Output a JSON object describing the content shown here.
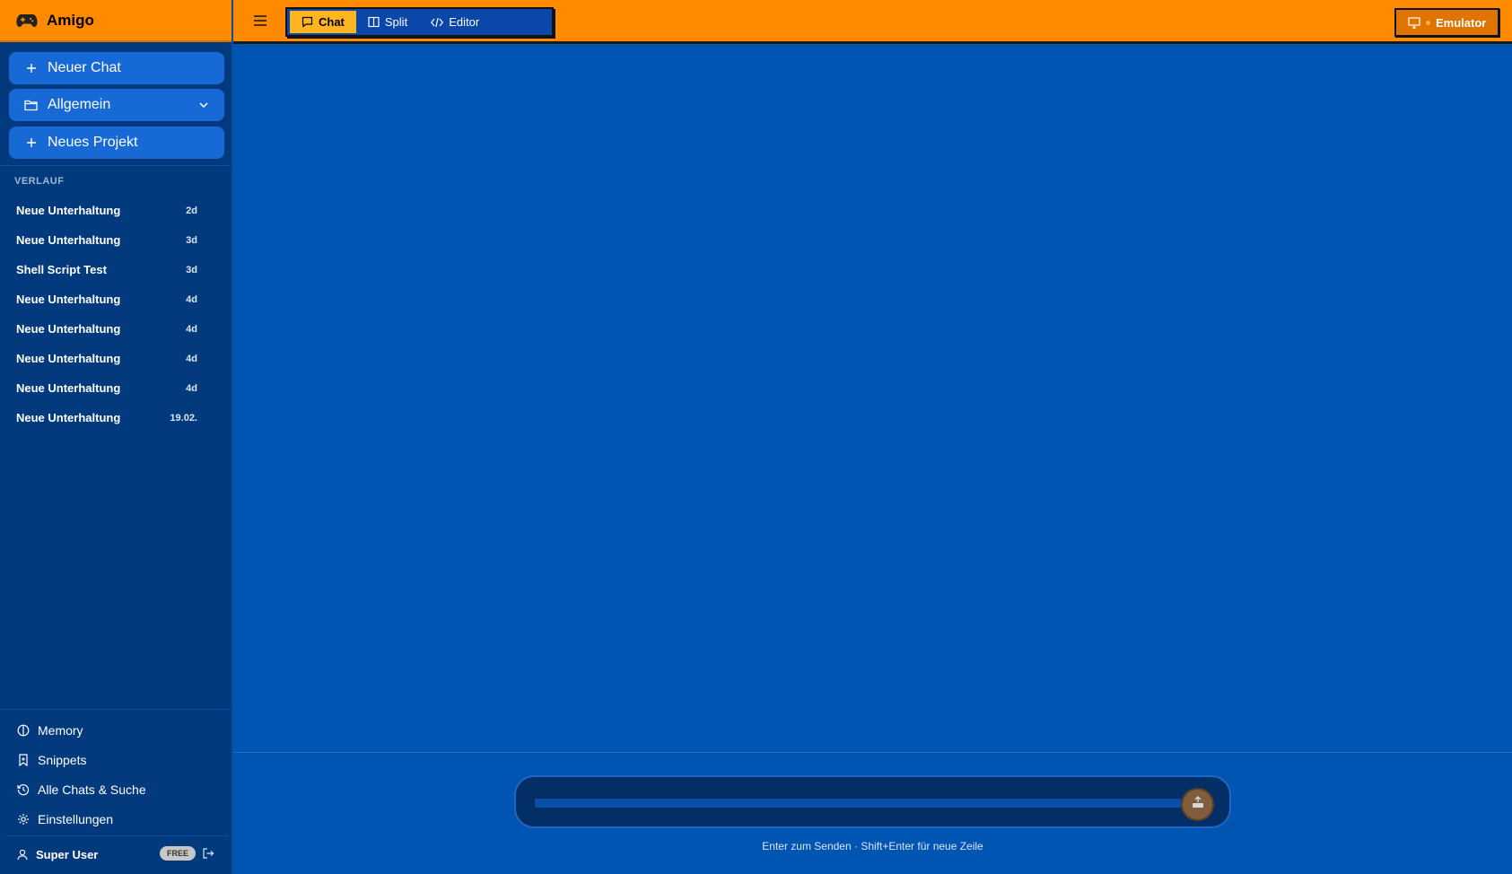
{
  "app": {
    "title": "Amigo"
  },
  "sidebar": {
    "new_chat": "Neuer Chat",
    "project_select": "Allgemein",
    "new_project": "Neues Projekt",
    "history_label": "VERLAUF",
    "history": [
      {
        "title": "Neue Unterhaltung",
        "time": "2d"
      },
      {
        "title": "Neue Unterhaltung",
        "time": "3d"
      },
      {
        "title": "Shell Script Test",
        "time": "3d"
      },
      {
        "title": "Neue Unterhaltung",
        "time": "4d"
      },
      {
        "title": "Neue Unterhaltung",
        "time": "4d"
      },
      {
        "title": "Neue Unterhaltung",
        "time": "4d"
      },
      {
        "title": "Neue Unterhaltung",
        "time": "4d"
      },
      {
        "title": "Neue Unterhaltung",
        "time": "19.02."
      }
    ],
    "nav": {
      "memory": "Memory",
      "snippets": "Snippets",
      "all_chats": "Alle Chats & Suche",
      "settings": "Einstellungen"
    },
    "user": {
      "name": "Super User",
      "plan": "FREE"
    }
  },
  "header": {
    "tabs": {
      "chat": "Chat",
      "split": "Split",
      "editor": "Editor"
    },
    "active_tab": "Chat",
    "emulator": "Emulator"
  },
  "composer": {
    "value": "",
    "hint": "Enter zum Senden · Shift+Enter für neue Zeile"
  },
  "colors": {
    "accent": "#ff8a00",
    "sidebar_bg": "#033a7d",
    "main_bg": "#0055b3",
    "button_bg": "#1769d6",
    "active_tab": "#ffb51f"
  }
}
